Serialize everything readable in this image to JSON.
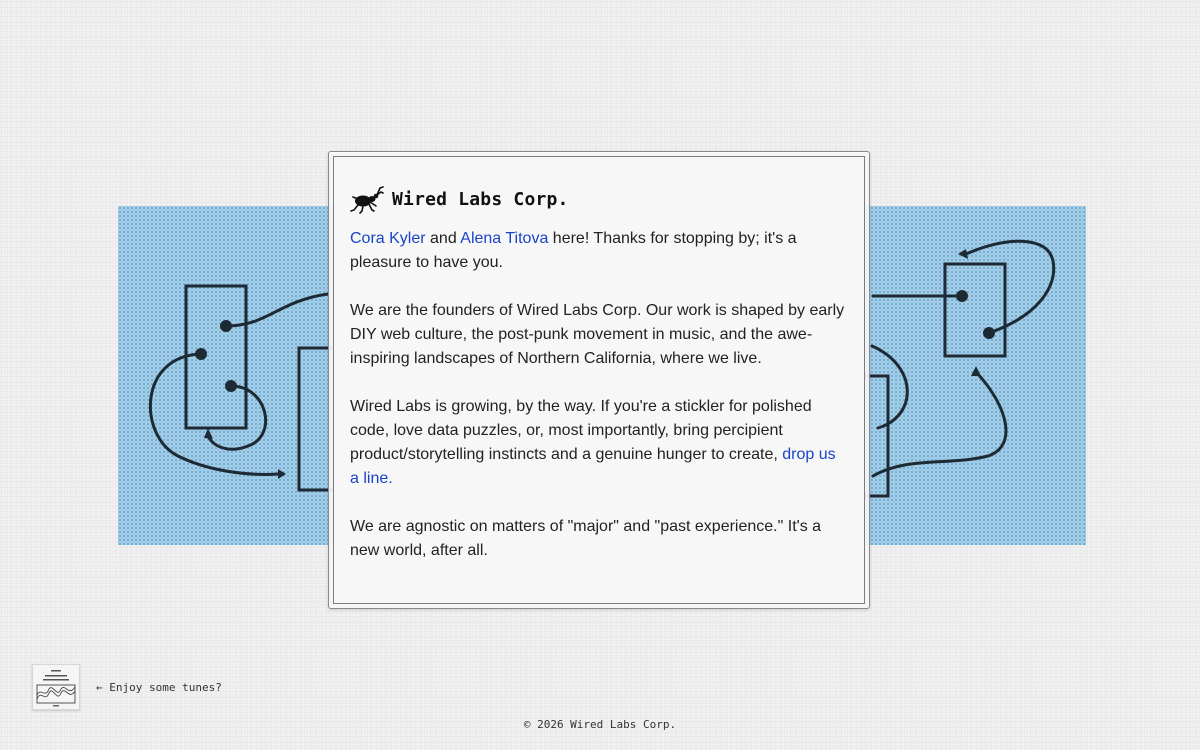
{
  "brand": {
    "name": "Wired Labs Corp.",
    "icon": "beetle-icon"
  },
  "intro": {
    "founder_1": "Cora Kyler",
    "and": " and ",
    "founder_2": "Alena Titova",
    "rest": " here! Thanks for stopping by; it's a pleasure to have you."
  },
  "about": "We are the founders of Wired Labs Corp. Our work is shaped by early DIY web culture, the post-punk movement in music, and the awe-inspiring landscapes of Northern California, where we live.",
  "hiring": {
    "text": "Wired Labs is growing, by the way. If you're a stickler for polished code, love data puzzles, or, most importantly, bring percipient product/storytelling instincts and a genuine hunger to create, ",
    "link": "drop us a line."
  },
  "agnostic": "We are agnostic on matters of \"major\" and \"past experience.\" It's a new world, after all.",
  "tunes": {
    "label": "← Enjoy some tunes?",
    "album_icon": "album-cover-icon"
  },
  "footer": "© 2026 Wired Labs Corp.",
  "colors": {
    "link": "#1a44c8",
    "art_background": "#aad0e8",
    "page_background": "#efefef"
  }
}
